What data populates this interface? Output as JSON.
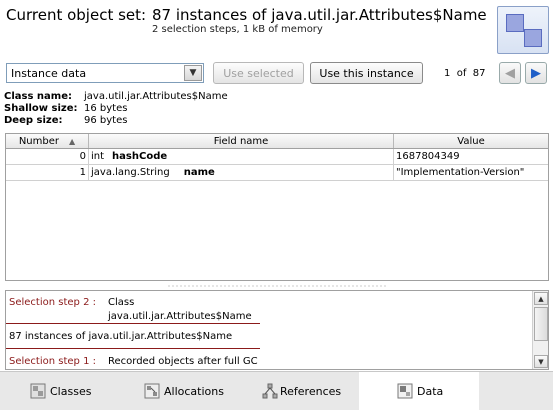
{
  "header": {
    "title": "Current object set:",
    "object_set": "87 instances of java.util.jar.Attributes$Name",
    "subtitle": "2 selection steps, 1 kB of memory",
    "logo_icon": "object-set-icon"
  },
  "toolbar": {
    "view_select": {
      "value": "Instance data",
      "icon": "chevron-down-icon"
    },
    "use_selected_label": "Use selected",
    "use_this_instance_label": "Use this instance",
    "pager": {
      "current": "1",
      "of": "of",
      "total": "87"
    },
    "prev_icon": "arrow-left-icon",
    "next_icon": "arrow-right-icon",
    "next_color": "#1f5fc8"
  },
  "info": {
    "class_name_key": "Class name:",
    "class_name_val": "java.util.jar.Attributes$Name",
    "shallow_key": "Shallow size:",
    "shallow_val": "16 bytes",
    "deep_key": "Deep size:",
    "deep_val": "96 bytes"
  },
  "table": {
    "columns": [
      "Number",
      "Field name",
      "Value"
    ],
    "rows": [
      {
        "number": "0",
        "type": "int",
        "name": "hashCode",
        "value": "1687804349"
      },
      {
        "number": "1",
        "type": "java.lang.String",
        "name": "name",
        "value": "\"Implementation-Version\""
      }
    ]
  },
  "steps": {
    "step2_label": "Selection step 2 :",
    "step2_line1": "Class",
    "step2_line2": "java.util.jar.Attributes$Name",
    "step2_result": "87 instances of java.util.jar.Attributes$Name",
    "step1_label": "Selection step 1 :",
    "step1_value": "Recorded objects after full GC",
    "separator_color": "#8b1a1a"
  },
  "tabs": [
    {
      "label": "Classes",
      "icon": "classes-icon"
    },
    {
      "label": "Allocations",
      "icon": "allocations-icon"
    },
    {
      "label": "References",
      "icon": "references-icon"
    },
    {
      "label": "Data",
      "icon": "data-icon",
      "active": true
    }
  ]
}
